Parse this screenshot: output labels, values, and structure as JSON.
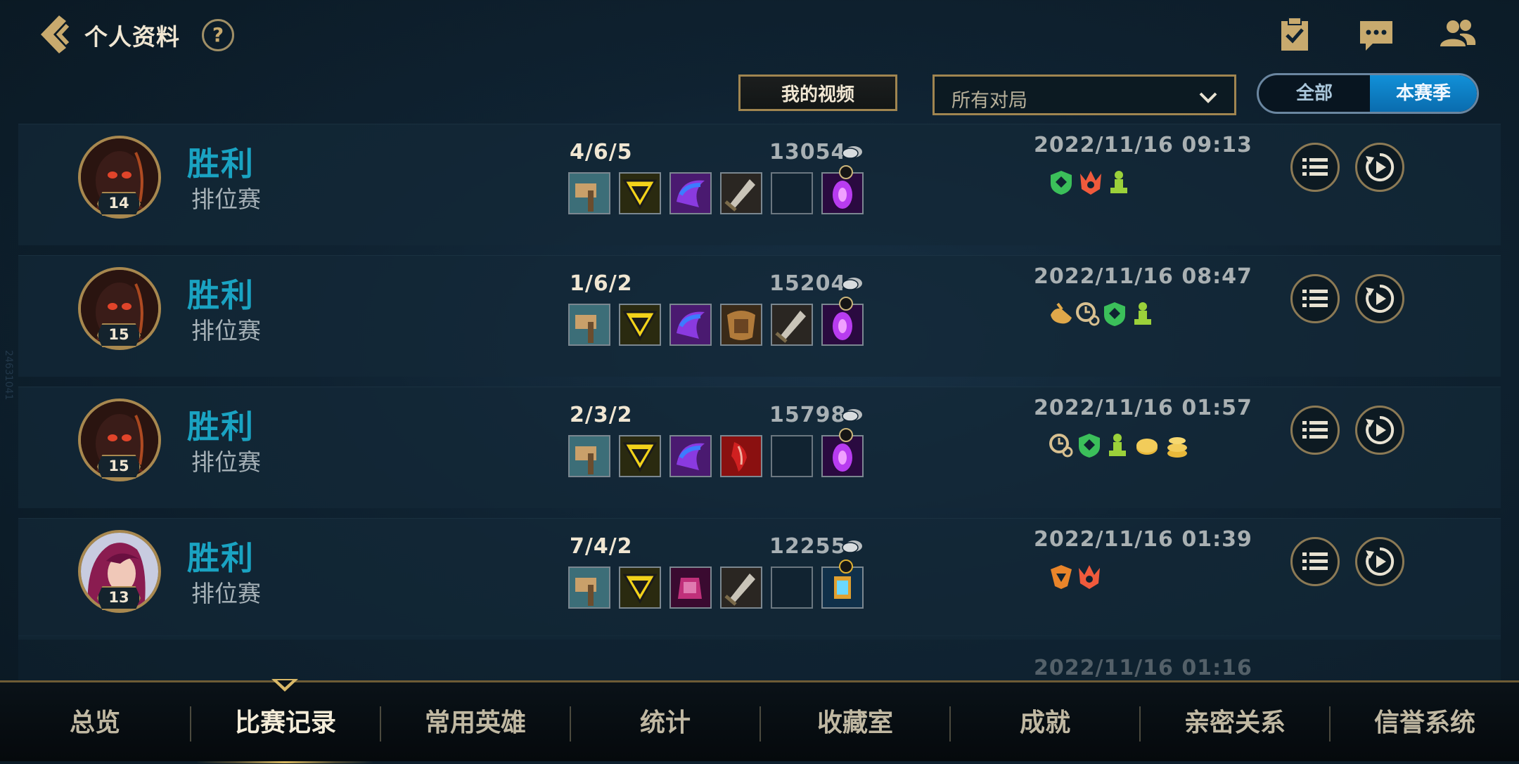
{
  "header": {
    "title": "个人资料",
    "help": "?",
    "icons": [
      "checklist-clipboard-icon",
      "chat-bubble-icon",
      "friends-icon"
    ]
  },
  "filters": {
    "video_button": "我的视频",
    "match_type": "所有对局",
    "scope_options": [
      "全部",
      "本赛季"
    ],
    "scope_selected": "本赛季"
  },
  "side_watermark": "24631041",
  "matches": [
    {
      "champion_level": "14",
      "result": "胜利",
      "queue": "排位赛",
      "kda": "4/6/5",
      "gold": "13054",
      "items": [
        "hammer-item",
        "yellow-triangle-item",
        "purple-cape-item",
        "steel-blade-item",
        "empty",
        "purple-crystal-trinket"
      ],
      "datetime": "2022/11/16 09:13",
      "badges": [
        "green-shield-badge",
        "red-crown-badge",
        "green-pawn-badge"
      ]
    },
    {
      "champion_level": "15",
      "result": "胜利",
      "queue": "排位赛",
      "kda": "1/6/2",
      "gold": "15204",
      "items": [
        "hammer-item",
        "yellow-triangle-item",
        "purple-cape-item",
        "gold-armor-item",
        "steel-blade-item",
        "purple-crystal-trinket"
      ],
      "datetime": "2022/11/16 08:47",
      "badges": [
        "gold-boot-badge",
        "clock-link-badge",
        "green-shield-badge",
        "green-pawn-badge"
      ]
    },
    {
      "champion_level": "15",
      "result": "胜利",
      "queue": "排位赛",
      "kda": "2/3/2",
      "gold": "15798",
      "items": [
        "hammer-item",
        "yellow-triangle-item",
        "purple-cape-item",
        "red-claw-item",
        "empty",
        "purple-crystal-trinket"
      ],
      "datetime": "2022/11/16 01:57",
      "badges": [
        "clock-link-badge",
        "green-shield-badge",
        "green-pawn-badge",
        "gold-coin-badge",
        "gold-stack-badge"
      ]
    },
    {
      "champion_level": "13",
      "result": "胜利",
      "queue": "排位赛",
      "kda": "7/4/2",
      "gold": "12255",
      "items": [
        "hammer-item",
        "yellow-triangle-item",
        "magenta-gauntlet-item",
        "steel-blade-item",
        "empty",
        "blue-lantern-trinket"
      ],
      "datetime": "2022/11/16 01:39",
      "badges": [
        "orange-crest-badge",
        "red-crown-badge"
      ]
    }
  ],
  "partial_match": {
    "datetime": "2022/11/16 01:16"
  },
  "bottom_nav": [
    "总览",
    "比赛记录",
    "常用英雄",
    "统计",
    "收藏室",
    "成就",
    "亲密关系",
    "信誉系统"
  ],
  "bottom_nav_active": "比赛记录",
  "colors": {
    "victory": "#1aa3c2",
    "gold_border": "#a8884f",
    "season_active": "#1190d8"
  }
}
